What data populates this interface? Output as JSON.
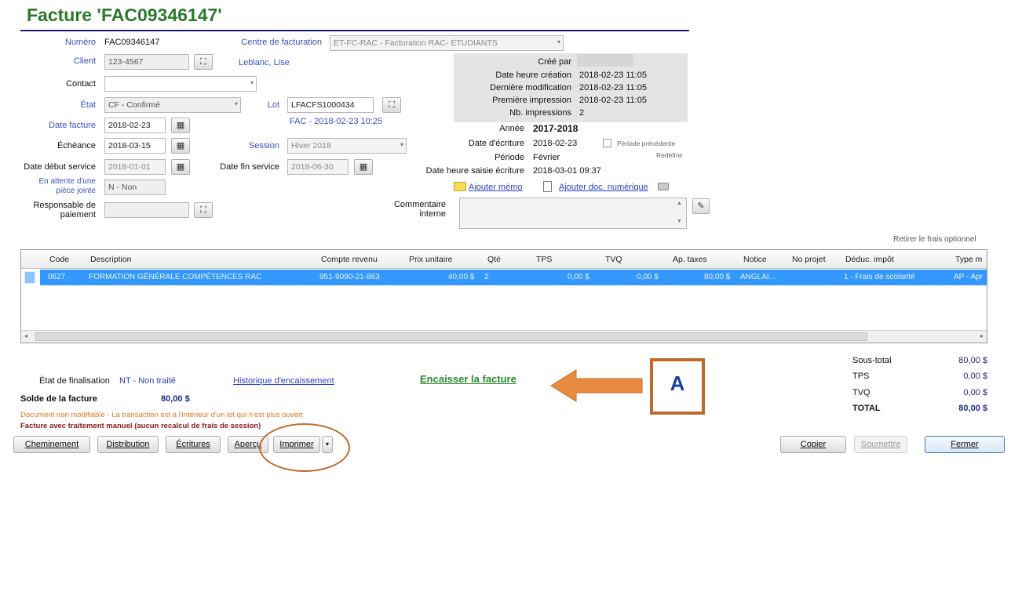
{
  "title": "Facture 'FAC09346147'",
  "form": {
    "numero_label": "Numéro",
    "numero_value": "FAC09346147",
    "centre_label": "Centre de facturation",
    "centre_value": "ET-FC-RAC - Facturation RAC- ÉTUDIANTS",
    "client_label": "Client",
    "client_value": "123-4567",
    "client_name": "Leblanc, Lise",
    "contact_label": "Contact",
    "contact_value": "",
    "etat_label": "État",
    "etat_value": "CF - Confirmé",
    "lot_label": "Lot",
    "lot_value": "LFACFS1000434",
    "lot_desc": "FAC - 2018-02-23 10:25",
    "date_facture_label": "Date facture",
    "date_facture_value": "2018-02-23",
    "echeance_label": "Échéance",
    "echeance_value": "2018-03-15",
    "session_label": "Session",
    "session_value": "Hiver 2018",
    "date_debut_label": "Date début service",
    "date_debut_value": "2018-01-01",
    "date_fin_label": "Date fin service",
    "date_fin_value": "2018-06-30",
    "attente_label": "En attente d'une pièce jointe",
    "attente_value": "N - Non",
    "responsable_label": "Responsable de paiement",
    "responsable_value": "",
    "commentaire_label": "Commentaire interne",
    "commentaire_value": ""
  },
  "info": {
    "cree_par_label": "Créé par",
    "cree_par_value": "",
    "date_creation_label": "Date heure création",
    "date_creation_value": "2018-02-23 11:05",
    "derniere_modif_label": "Dernière modification",
    "derniere_modif_value": "2018-02-23 11:05",
    "premiere_impr_label": "Première impression",
    "premiere_impr_value": "2018-02-23 11:05",
    "nb_impr_label": "Nb. impressions",
    "nb_impr_value": "2",
    "annee_label": "Année",
    "annee_value": "2017-2018",
    "date_ecriture_label": "Date d'écriture",
    "date_ecriture_value": "2018-02-23",
    "periode_prec_label": "Période précédente",
    "periode_label": "Période",
    "periode_value": "Février",
    "redefinir": "Redéfinir",
    "saisie_label": "Date heure saisie écriture",
    "saisie_value": "2018-03-01 09:37",
    "ajouter_memo": "Ajouter mémo",
    "ajouter_doc": "Ajouter doc. numérique"
  },
  "retirer_frais": "Retirer le frais optionnel",
  "grid": {
    "headers": [
      "Code",
      "Description",
      "Compte revenu",
      "Prix unitaire",
      "Qté",
      "TPS",
      "TVQ",
      "Ap. taxes",
      "Notice",
      "No projet",
      "Déduc. impôt",
      "Type m"
    ],
    "rows": [
      [
        "0627",
        "FORMATION GÉNÉRALE COMPÉTENCES RAC",
        "951-9090-21-863",
        "40,00 $",
        "2",
        "0,00 $",
        "0,00 $",
        "80,00 $",
        "ANGLAI...",
        "",
        "1 - Frais de scolarité",
        "AP - Apr"
      ]
    ]
  },
  "footer": {
    "etat_final_label": "État de finalisation",
    "etat_final_value": "NT - Non traité",
    "historique_link": "Historique d'encaissement",
    "encaisser_link": "Encaisser la facture",
    "annotation_letter": "A",
    "solde_label": "Solde de la facture",
    "solde_value": "80,00 $",
    "warning_orange": "Document non modifiable - La transaction est à l'intérieur d'un lot qui n'est plus ouvert",
    "warning_red": "Facture avec traitement manuel (aucun recalcul de frais de session)",
    "soustotal_label": "Sous-total",
    "soustotal_value": "80,00 $",
    "tps_label": "TPS",
    "tps_value": "0,00 $",
    "tvq_label": "TVQ",
    "tvq_value": "0,00 $",
    "total_label": "TOTAL",
    "total_value": "80,00 $"
  },
  "buttons": {
    "cheminement": "Cheminement",
    "distribution": "Distribution",
    "ecritures": "Écritures",
    "apercu": "Aperçu",
    "imprimer": "Imprimer",
    "copier": "Copier",
    "soumettre": "Soumettre",
    "fermer": "Fermer"
  },
  "colors": {
    "title_green": "#2a7a2a",
    "link_blue": "#2c3fc2",
    "selection_blue": "#3399ff",
    "annotation_orange": "#c0692a",
    "warning_orange": "#e0781e",
    "warning_red": "#8b1a1a"
  }
}
